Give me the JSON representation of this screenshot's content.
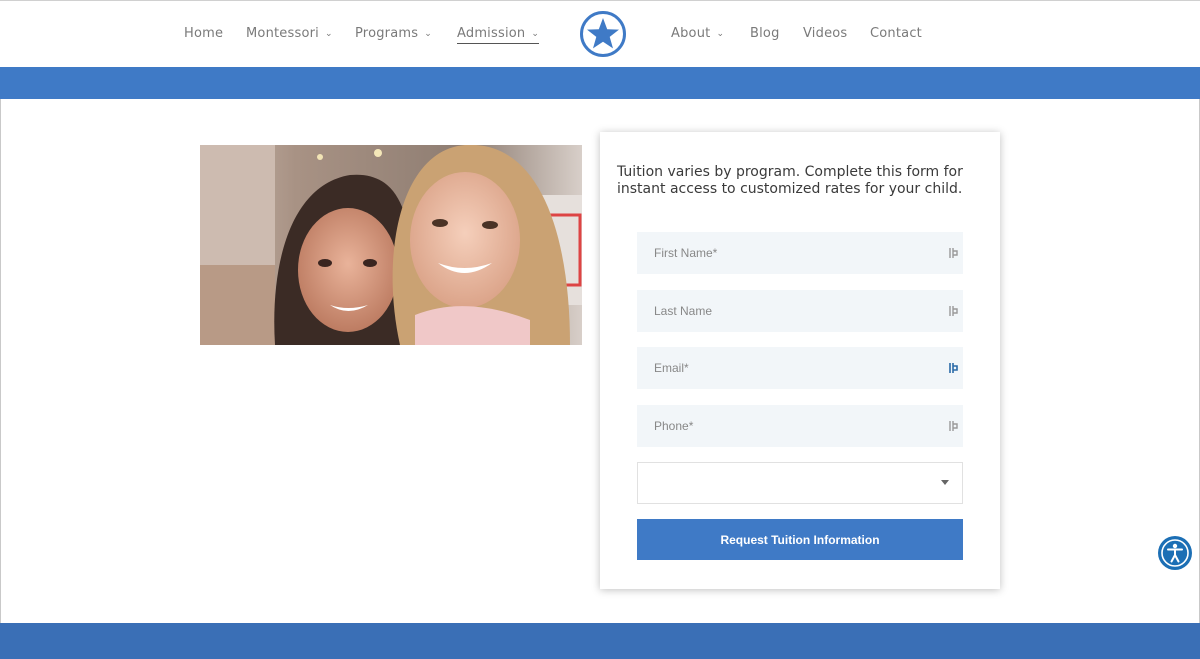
{
  "nav": {
    "items": [
      {
        "label": "Home",
        "dropdown": false
      },
      {
        "label": "Montessori",
        "dropdown": true
      },
      {
        "label": "Programs",
        "dropdown": true
      },
      {
        "label": "Admission",
        "dropdown": true,
        "active": true
      },
      {
        "label": "About",
        "dropdown": true
      },
      {
        "label": "Blog",
        "dropdown": false
      },
      {
        "label": "Videos",
        "dropdown": false
      },
      {
        "label": "Contact",
        "dropdown": false
      }
    ],
    "logo_icon": "star-logo-icon",
    "chevron_icon": "chevron-down-icon"
  },
  "colors": {
    "brand_blue": "#3f7ac6",
    "footer_blue": "#3a6fb6",
    "field_bg": "#f2f6f9",
    "accessibility_blue": "#1c6fb5"
  },
  "form": {
    "intro": "Tuition varies by program. Complete this form for instant access to customized rates for your child.",
    "first_name_placeholder": "First Name*",
    "last_name_placeholder": "Last Name",
    "email_placeholder": "Email*",
    "phone_placeholder": "Phone*",
    "program_select_value": "",
    "submit_label": "Request Tuition Information"
  },
  "photo": {
    "icon": "children-photo"
  },
  "accessibility": {
    "icon": "accessibility-icon"
  }
}
